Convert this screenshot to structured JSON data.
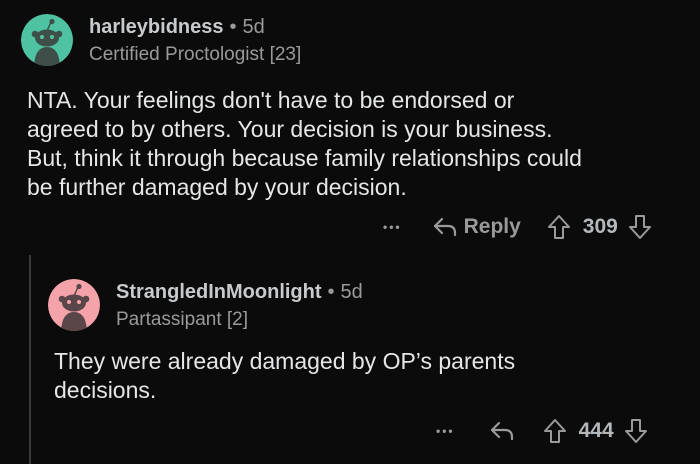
{
  "comments": [
    {
      "username": "harleybidness",
      "separator": "•",
      "age": "5d",
      "flair": "Certified Proctologist [23]",
      "body_lines": [
        "NTA.  Your feelings don't have to be endorsed or",
        "agreed to by others.   Your decision is your business.",
        "But, think it through because family relationships could",
        "be further damaged by your decision."
      ],
      "more_label": "•••",
      "reply_label": "Reply",
      "score": "309",
      "avatar_color": "#4fc3a1"
    },
    {
      "username": "StrangledInMoonlight",
      "separator": "•",
      "age": "5d",
      "flair": "Partassipant [2]",
      "body_lines": [
        "They were already damaged by OP’s parents",
        "decisions."
      ],
      "more_label": "•••",
      "score": "444",
      "avatar_color": "#f4a3aa"
    }
  ],
  "icons": [
    "reddit-snoo-avatar-icon",
    "reply-arrow-icon",
    "upvote-icon",
    "downvote-icon"
  ]
}
